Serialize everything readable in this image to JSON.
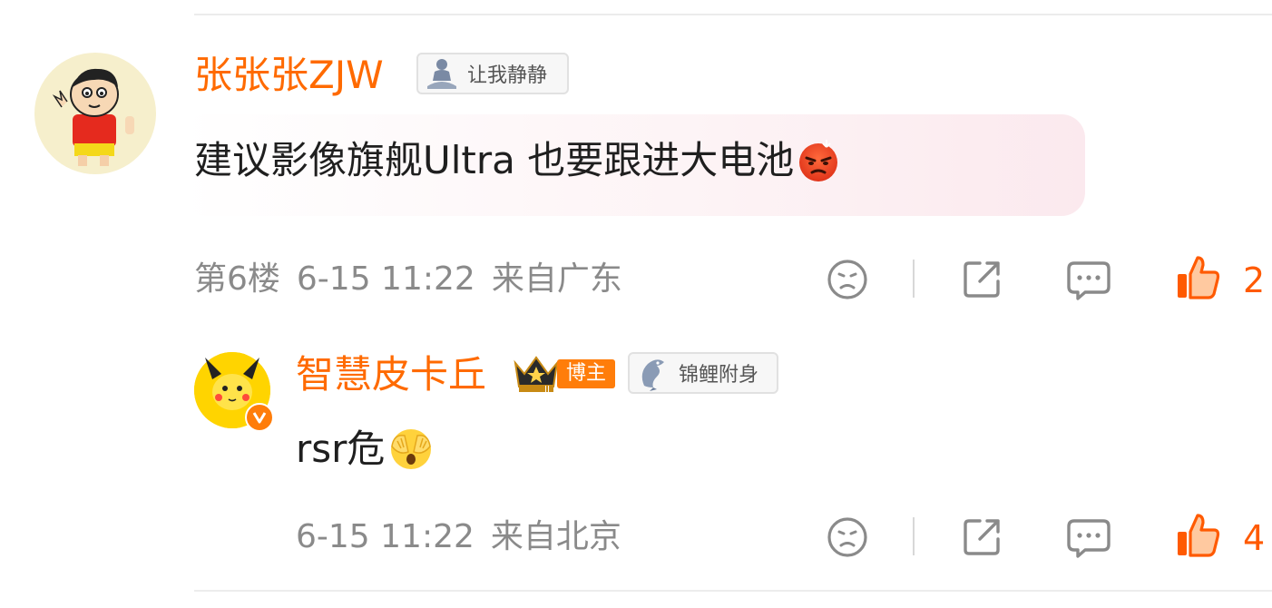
{
  "colors": {
    "accent": "#ff6a00",
    "meta": "#8a8a8a",
    "like": "#ff5a00"
  },
  "comment": {
    "username": "张张张ZJW",
    "badge_label": "让我静静",
    "badge_icon": "meditation-person-icon",
    "text": "建议影像旗舰Ultra 也要跟进大电池",
    "emoji": "angry-face-emoji",
    "floor": "第6楼",
    "time": "6-15 11:22",
    "location": "来自广东",
    "likes": "2"
  },
  "reply": {
    "username": "智慧皮卡丘",
    "vip_tag": "博主",
    "badge_label": "锦鲤附身",
    "badge_icon": "koi-fish-icon",
    "text": "rsr危",
    "emoji": "hands-over-eyes-emoji",
    "time": "6-15 11:22",
    "location": "来自北京",
    "likes": "4"
  }
}
